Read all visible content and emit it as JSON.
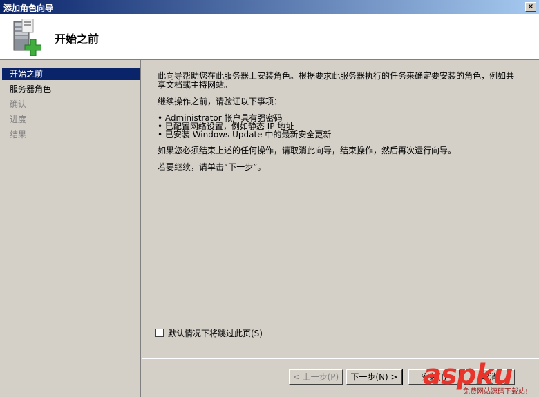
{
  "window": {
    "title": "添加角色向导",
    "close_glyph": "×"
  },
  "header": {
    "title": "开始之前",
    "icon": "server-add-icon"
  },
  "nav": {
    "items": [
      {
        "label": "开始之前",
        "state": "active"
      },
      {
        "label": "服务器角色",
        "state": "normal"
      },
      {
        "label": "确认",
        "state": "disabled"
      },
      {
        "label": "进度",
        "state": "disabled"
      },
      {
        "label": "结果",
        "state": "disabled"
      }
    ]
  },
  "content": {
    "intro_line1": "此向导帮助您在此服务器上安装角色。根据要求此服务器执行的任务来确定要安装的角色，例如共",
    "intro_line2": "享文档或主持网站。",
    "verify_heading": "继续操作之前，请验证以下事项：",
    "bullets": [
      "• Administrator 帐户具有强密码",
      "• 已配置网络设置，例如静态 IP 地址",
      "• 已安装 Windows Update 中的最新安全更新"
    ],
    "cancel_note": "如果您必须结束上述的任何操作，请取消此向导，结束操作，然后再次运行向导。",
    "continue_note": "若要继续，请单击“下一步”。",
    "skip_checkbox": {
      "label": "默认情况下将跳过此页(S)",
      "checked": false
    }
  },
  "buttons": {
    "back": "< 上一步(P)",
    "next": "下一步(N) >",
    "install": "安装(I)",
    "cancel": "取消"
  },
  "watermark": {
    "logo": "aspku",
    "sub": "免费网站源码下载站!"
  },
  "colors": {
    "selection": "#0a246a",
    "face": "#d4d0c8",
    "watermark": "#e8342a"
  }
}
